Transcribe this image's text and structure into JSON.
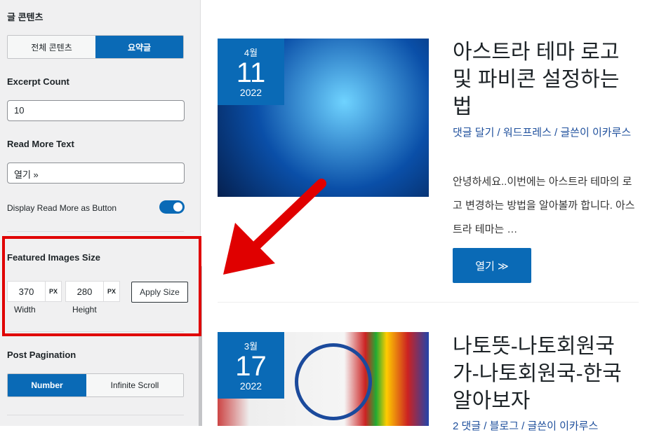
{
  "sidebar": {
    "post_content": {
      "label": "글 콘텐츠",
      "options": [
        "전체 콘텐츠",
        "요약글"
      ],
      "selected": "요약글"
    },
    "excerpt_count": {
      "label": "Excerpt Count",
      "value": "10"
    },
    "read_more_text": {
      "label": "Read More Text",
      "value": "열기 »"
    },
    "read_more_button": {
      "label": "Display Read More as Button",
      "on": true
    },
    "featured_images": {
      "label": "Featured Images Size",
      "width": "370",
      "height": "280",
      "unit": "PX",
      "width_label": "Width",
      "height_label": "Height",
      "apply": "Apply Size"
    },
    "pagination": {
      "label": "Post Pagination",
      "options": [
        "Number",
        "Infinite Scroll"
      ],
      "selected": "Number"
    }
  },
  "posts": [
    {
      "month": "4월",
      "day": "11",
      "year": "2022",
      "title": "아스트라 테마 로고 및 파비콘 설정하는 법",
      "meta": "댓글 달기 / 워드프레스 / 글쓴이 이카루스",
      "excerpt": "안녕하세요..이번에는 아스트라 테마의 로고 변경하는 방법을 알아볼까 합니다. 아스트라 테마는 …",
      "button": "열기 ≫"
    },
    {
      "month": "3월",
      "day": "17",
      "year": "2022",
      "title": "나토뜻-나토회원국가-나토회원국-한국 알아보자",
      "meta": "2 댓글 / 블로그 / 글쓴이 이카루스"
    }
  ],
  "colors": {
    "accent": "#0a6ab6",
    "highlight": "#e00000"
  }
}
